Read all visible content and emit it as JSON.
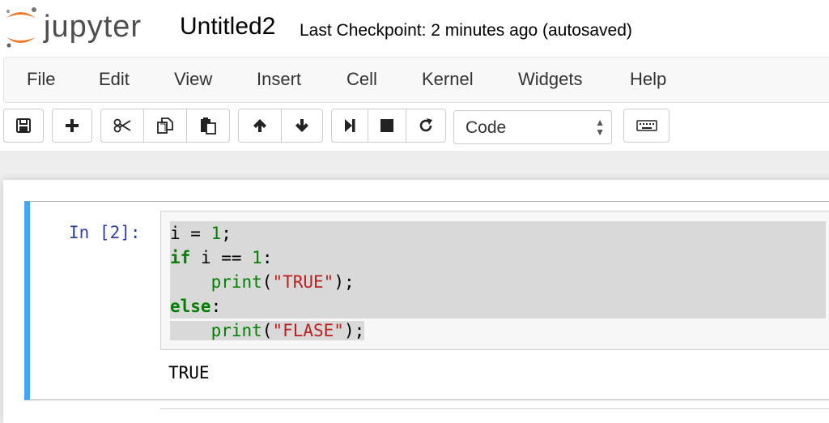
{
  "header": {
    "logo_text": "jupyter",
    "notebook_title": "Untitled2",
    "checkpoint_status": "Last Checkpoint: 2 minutes ago (autosaved)"
  },
  "menubar": {
    "items": [
      "File",
      "Edit",
      "View",
      "Insert",
      "Cell",
      "Kernel",
      "Widgets",
      "Help"
    ]
  },
  "toolbar": {
    "buttons": [
      {
        "name": "save",
        "icon": "floppy-disk-icon"
      },
      {
        "name": "insert-cell-below",
        "icon": "plus-icon"
      },
      {
        "name": "cut",
        "icon": "scissors-icon"
      },
      {
        "name": "copy",
        "icon": "copy-icon"
      },
      {
        "name": "paste",
        "icon": "paste-icon"
      },
      {
        "name": "move-up",
        "icon": "arrow-up-icon"
      },
      {
        "name": "move-down",
        "icon": "arrow-down-icon"
      },
      {
        "name": "run",
        "icon": "step-forward-icon"
      },
      {
        "name": "interrupt",
        "icon": "stop-icon"
      },
      {
        "name": "restart",
        "icon": "refresh-icon"
      },
      {
        "name": "command-palette",
        "icon": "keyboard-icon"
      }
    ],
    "cell_type": "Code"
  },
  "cell": {
    "prompt": "In [2]:",
    "code_lines": [
      "i = 1;",
      "if i == 1:",
      "    print(\"TRUE\");",
      "else:",
      "    print(\"FLASE\");"
    ],
    "output": "TRUE"
  },
  "colors": {
    "selected_cell_border": "#42a5f5",
    "prompt": "#303f9f",
    "keyword": "#008000",
    "string": "#ba2121",
    "logo_orange": "#f37726"
  }
}
